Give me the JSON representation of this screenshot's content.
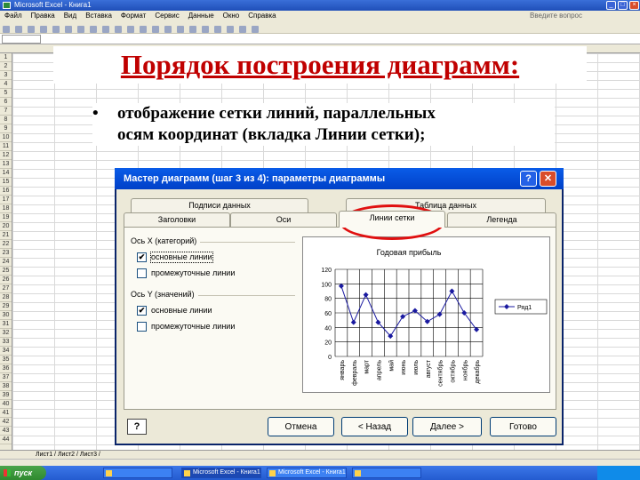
{
  "excel": {
    "title": "Microsoft Excel - Книга1",
    "menu": [
      "Файл",
      "Правка",
      "Вид",
      "Вставка",
      "Формат",
      "Сервис",
      "Данные",
      "Окно",
      "Справка"
    ],
    "help_placeholder": "Введите вопрос",
    "sheet_tabs": "Лист1 / Лист2 / Лист3 /",
    "row_numbers": [
      "1",
      "2",
      "3",
      "4",
      "5",
      "6",
      "7",
      "8",
      "9",
      "10",
      "11",
      "12",
      "13",
      "14",
      "15",
      "16",
      "17",
      "18",
      "19",
      "20",
      "21",
      "22",
      "23",
      "24",
      "25",
      "26",
      "27",
      "28",
      "29",
      "30",
      "31",
      "32",
      "33",
      "34",
      "35",
      "36",
      "37",
      "38",
      "39",
      "40",
      "41",
      "42",
      "43",
      "44"
    ]
  },
  "taskbar": {
    "start_label": "пуск",
    "items": [
      "",
      "Microsoft Excel - Книга1",
      "Microsoft Excel - Книга1",
      ""
    ]
  },
  "slide": {
    "title": "Порядок построения диаграмм:",
    "bullet": "•",
    "bullet_text_line1": "отображение сетки линий, параллельных",
    "bullet_text_line2": "осям координат (вкладка Линии сетки);"
  },
  "dialog": {
    "title": "Мастер диаграмм (шаг 3 из 4): параметры диаграммы",
    "help_btn": "?",
    "close_btn": "✕",
    "tabs_back": [
      "Подписи данных",
      "Таблица данных"
    ],
    "tabs_front": [
      "Заголовки",
      "Оси",
      "Линии сетки",
      "Легенда"
    ],
    "selected_tab": "Линии сетки",
    "x_group": "Ось X (категорий)",
    "y_group": "Ось Y (значений)",
    "x_major": "основные линии",
    "x_minor": "промежуточные линии",
    "y_major": "основные линии",
    "y_minor": "промежуточные линии",
    "x_major_checked": true,
    "x_minor_checked": false,
    "y_major_checked": true,
    "y_minor_checked": false,
    "buttons": {
      "cancel": "Отмена",
      "back": "< Назад",
      "next": "Далее >",
      "finish": "Готово"
    }
  },
  "chart_data": {
    "type": "line",
    "title": "Годовая прибыль",
    "categories": [
      "январь",
      "февраль",
      "март",
      "апрель",
      "май",
      "июнь",
      "июль",
      "август",
      "сентябрь",
      "октябрь",
      "ноябрь",
      "декабрь"
    ],
    "series": [
      {
        "name": "Ряд1",
        "values": [
          97,
          47,
          85,
          47,
          28,
          55,
          63,
          48,
          58,
          90,
          60,
          37
        ]
      }
    ],
    "yticks": [
      "0",
      "20",
      "40",
      "60",
      "80",
      "100",
      "120"
    ],
    "ylim": [
      0,
      120
    ],
    "grid": "major-x-and-y",
    "legend_position": "right",
    "colors": {
      "series": "#1a1aa0"
    }
  }
}
